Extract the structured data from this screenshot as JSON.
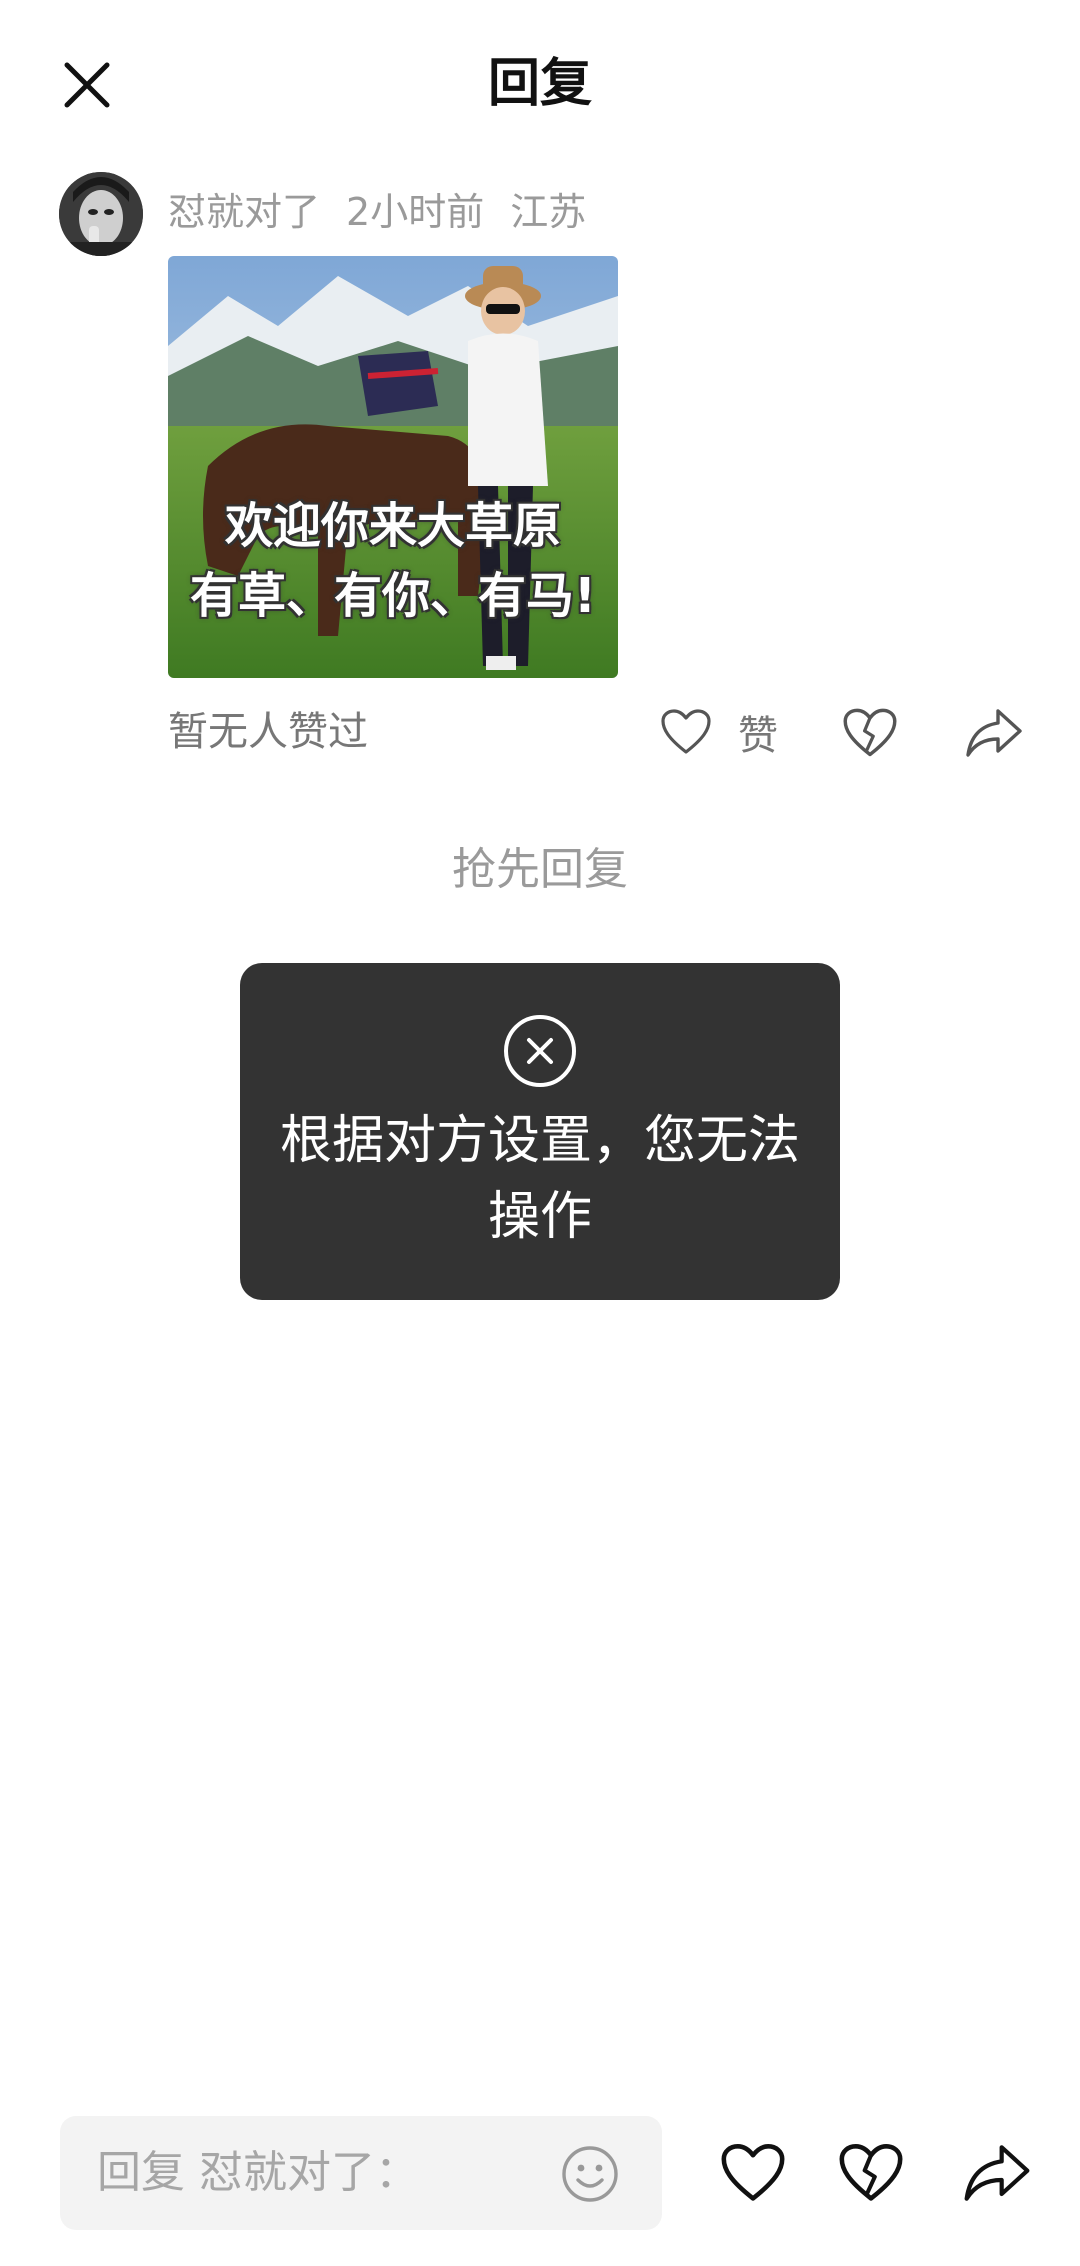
{
  "header": {
    "title": "回复",
    "close_icon": "close-icon"
  },
  "comment": {
    "username": "怼就对了",
    "time": "2小时前",
    "location": "江苏",
    "image": {
      "caption_line1": "欢迎你来大草原",
      "caption_line2": "有草、有你、有马!"
    },
    "likes_status": "暂无人赞过",
    "like_label": "赞",
    "icons": {
      "like": "heart-icon",
      "dislike": "broken-heart-icon",
      "share": "share-arrow-icon"
    }
  },
  "first_reply_label": "抢先回复",
  "toast": {
    "icon": "circle-x-icon",
    "message": "根据对方设置，您无法操作"
  },
  "bottom_bar": {
    "placeholder": "回复 怼就对了：",
    "emoji_icon": "smile-emoji-icon",
    "like_icon": "heart-icon",
    "dislike_icon": "broken-heart-icon",
    "share_icon": "share-arrow-icon"
  }
}
